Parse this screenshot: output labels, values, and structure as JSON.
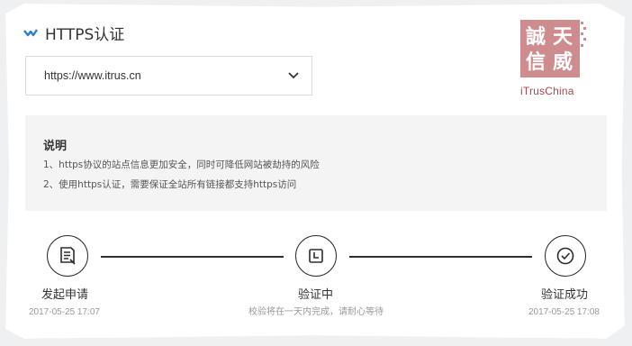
{
  "title": "HTTPS认证",
  "domain_select": {
    "value": "https://www.itrus.cn"
  },
  "logo": {
    "chars": [
      "誠",
      "天",
      "信",
      "威"
    ],
    "caption": "iTrusChina",
    "color": "#cf8c8f"
  },
  "notice": {
    "title": "说明",
    "items": [
      "1、https协议的站点信息更加安全，同时可降低网站被劫持的风险",
      "2、使用https认证，需要保证全站所有链接都支持https访问"
    ]
  },
  "steps": [
    {
      "label": "发起申请",
      "time": "2017-05-25 17:07",
      "icon": "document-icon"
    },
    {
      "label": "验证中",
      "note": "校验将在一天内完成，请耐心等待",
      "icon": "clock-icon"
    },
    {
      "label": "验证成功",
      "time": "2017-05-25 17:08",
      "icon": "check-circle-icon"
    }
  ],
  "colors": {
    "accent": "#2b7fd0",
    "line": "#2d2d2d",
    "notice_bg": "#f4f4f4"
  }
}
